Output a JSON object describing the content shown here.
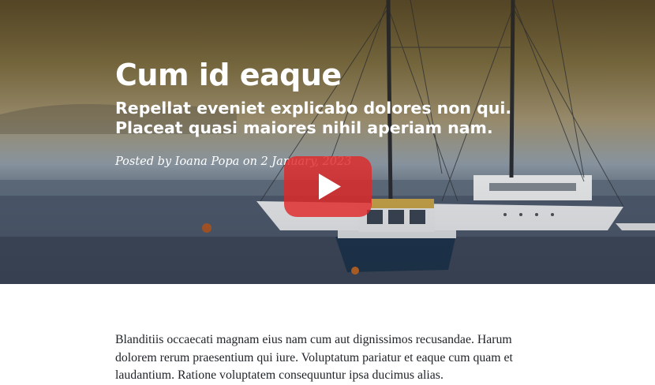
{
  "post": {
    "title": "Cum id eaque",
    "subtitle": "Repellat eveniet explicabo dolores non qui. Placeat quasi maiores nihil aperiam nam.",
    "meta": "Posted by Ioana Popa on 2 January, 2023"
  },
  "video": {
    "play_icon": "play-icon",
    "button_color": "#e02828"
  },
  "body": {
    "paragraph": "Blanditiis occaecati magnam eius nam cum aut dignissimos recusandae. Harum dolorem rerum praesentium qui iure. Voluptatum pariatur et eaque cum quam et laudantium. Ratione voluptatem consequuntur ipsa ducimus alias."
  }
}
